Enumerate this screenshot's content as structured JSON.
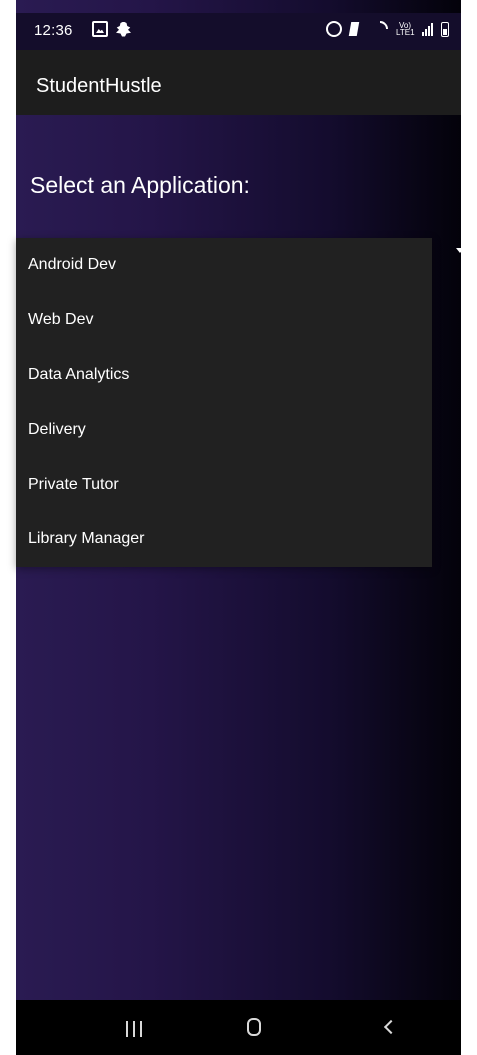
{
  "status_bar": {
    "time": "12:36",
    "left_icons": [
      "gallery-icon",
      "snapchat-icon"
    ],
    "right_icons": [
      "alarm-icon",
      "mute-icon",
      "wifi-icon",
      "lte-icon",
      "signal-icon",
      "battery-icon"
    ],
    "lte_text": "Vo) LTE1"
  },
  "app_bar": {
    "title": "StudentHustle"
  },
  "page": {
    "heading": "Select an Application:"
  },
  "dropdown": {
    "items": [
      "Android Dev",
      "Web Dev",
      "Data Analytics",
      "Delivery",
      "Private Tutor",
      "Library Manager"
    ]
  },
  "nav_bar": {
    "icons": [
      "recent-apps-icon",
      "home-icon",
      "back-icon"
    ]
  },
  "colors": {
    "background_start": "#2a1b52",
    "background_end": "#03020a",
    "app_bar": "#1d1d1d",
    "dropdown": "#212121",
    "text": "#ffffff"
  }
}
